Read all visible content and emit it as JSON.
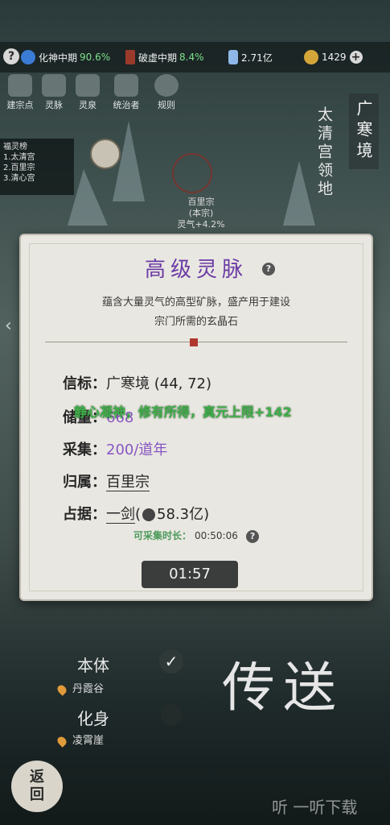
{
  "statusbar": {
    "help": "?",
    "stat1_label": "化神中期",
    "stat1_pct": "90.6%",
    "stat2_label": "破虚中期",
    "stat2_pct": "8.4%",
    "stat3_value": "2.71亿",
    "stat4_value": "1429",
    "plus": "+"
  },
  "menu": {
    "items": [
      {
        "label": "建宗点"
      },
      {
        "label": "灵脉"
      },
      {
        "label": "灵泉"
      },
      {
        "label": "统治者"
      },
      {
        "label": "规则"
      }
    ]
  },
  "rank": {
    "title": "福灵榜",
    "items": [
      "1.太清宫",
      "2.百里宗",
      "3.清心宫"
    ]
  },
  "territory": {
    "big": "广寒境",
    "small": "太清宫领地"
  },
  "sect": {
    "name": "百里宗",
    "tag": "(本宗)",
    "bonus": "灵气+4.2%"
  },
  "modal": {
    "title": "高级灵脉",
    "help": "?",
    "desc_line1": "蕴含大量灵气的高型矿脉，盛产用于建设",
    "desc_line2": "宗门所需的玄晶石",
    "beacon_label": "信标：",
    "beacon_value": "广寒境 (44, 72)",
    "stock_label": "储量：",
    "stock_value": "668",
    "collect_label": "采集：",
    "collect_value": "200/道年",
    "owner_label": "归属：",
    "owner_value": "百里宗",
    "occupy_label": "占据：",
    "occupy_value": "一剑",
    "occupy_power": "58.3亿",
    "collect_time_label": "可采集时长：",
    "collect_time_value": "00:50:06",
    "float_msg": "静心凝神，修有所得，真元上限+142",
    "timer": "01:57"
  },
  "bottom": {
    "main_body": "本体",
    "main_loc": "丹霞谷",
    "avatar_body": "化身",
    "avatar_loc": "凌霄崖",
    "teleport": "传送",
    "back_top": "返",
    "back_bottom": "回",
    "check": "✓"
  },
  "watermark": "听 一听下载"
}
